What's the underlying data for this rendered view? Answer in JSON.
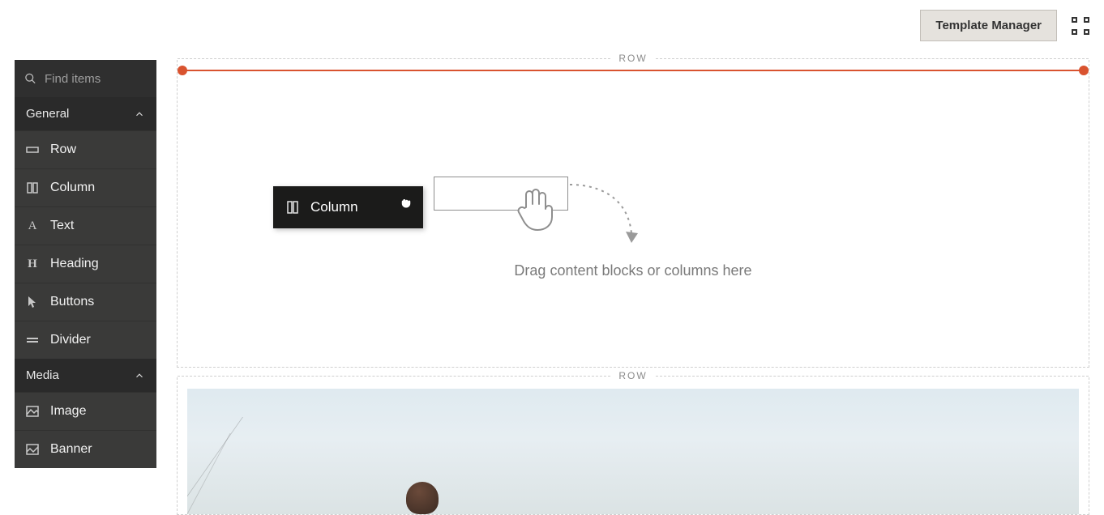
{
  "header": {
    "template_manager_label": "Template Manager"
  },
  "sidebar": {
    "search_placeholder": "Find items",
    "sections": {
      "general": {
        "label": "General",
        "items": {
          "row": "Row",
          "column": "Column",
          "text": "Text",
          "heading": "Heading",
          "buttons": "Buttons",
          "divider": "Divider"
        }
      },
      "media": {
        "label": "Media",
        "items": {
          "image": "Image",
          "banner": "Banner"
        }
      }
    }
  },
  "canvas": {
    "row_label": "ROW",
    "drop_text": "Drag content blocks or columns here",
    "drag_chip_label": "Column"
  }
}
